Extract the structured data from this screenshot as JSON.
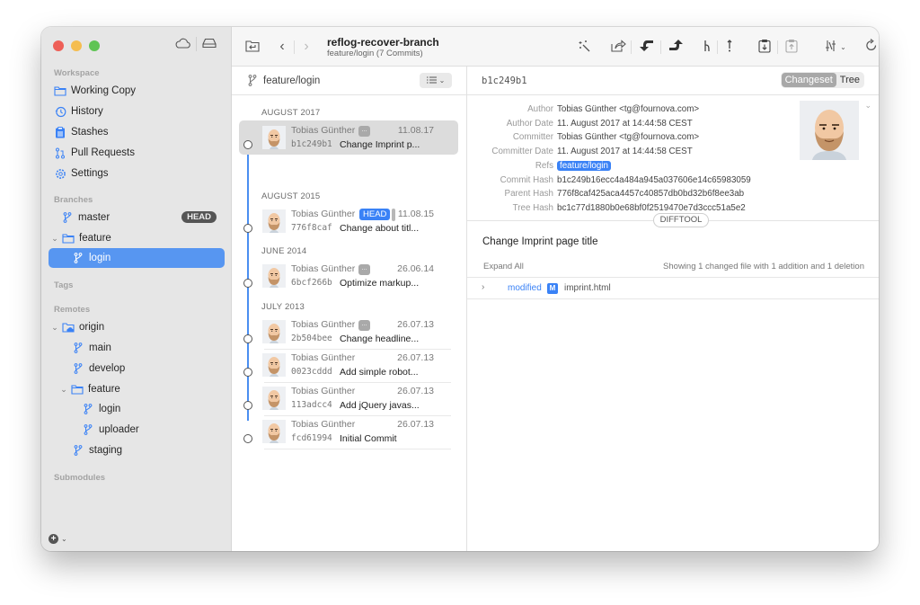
{
  "sidebar": {
    "workspace_label": "Workspace",
    "workspace_items": [
      {
        "label": "Working Copy",
        "icon": "folder-icon"
      },
      {
        "label": "History",
        "icon": "history-icon"
      },
      {
        "label": "Stashes",
        "icon": "clipboard-icon"
      },
      {
        "label": "Pull Requests",
        "icon": "pull-request-icon"
      },
      {
        "label": "Settings",
        "icon": "gear-icon"
      }
    ],
    "branches_label": "Branches",
    "branches": {
      "master": "master",
      "head_badge": "HEAD",
      "feature_folder": "feature",
      "login": "login"
    },
    "tags_label": "Tags",
    "remotes_label": "Remotes",
    "remotes": {
      "origin": "origin",
      "main": "main",
      "develop": "develop",
      "feature_folder": "feature",
      "login": "login",
      "uploader": "uploader",
      "staging": "staging"
    },
    "submodules_label": "Submodules"
  },
  "toolbar": {
    "title": "reflog-recover-branch",
    "subtitle": "feature/login (7 Commits)",
    "icons": [
      "magic-wand-icon",
      "share-icon",
      "pull-icon",
      "push-icon",
      "merge-icon",
      "stash-icon",
      "stash-apply-icon",
      "stash-pop-icon",
      "filter-icon",
      "refresh-icon",
      "search-icon"
    ]
  },
  "commit_list": {
    "branch": "feature/login",
    "groups": [
      {
        "month": "AUGUST 2017"
      },
      {
        "month": "AUGUST 2015"
      },
      {
        "month": "JUNE 2014"
      },
      {
        "month": "JULY 2013"
      }
    ],
    "commits": [
      {
        "author": "Tobias Günther",
        "date": "11.08.17",
        "hash": "b1c249b1",
        "message": "Change Imprint p...",
        "more": "...",
        "selected": true
      },
      {
        "author": "Tobias Günther",
        "date": "11.08.15",
        "hash": "776f8caf",
        "message": "Change about titl...",
        "tag": "HEAD"
      },
      {
        "author": "Tobias Günther",
        "date": "26.06.14",
        "hash": "6bcf266b",
        "message": "Optimize markup...",
        "more": "..."
      },
      {
        "author": "Tobias Günther",
        "date": "26.07.13",
        "hash": "2b504bee",
        "message": "Change headline...",
        "more": "..."
      },
      {
        "author": "Tobias Günther",
        "date": "26.07.13",
        "hash": "0023cddd",
        "message": "Add simple robot..."
      },
      {
        "author": "Tobias Günther",
        "date": "26.07.13",
        "hash": "113adcc4",
        "message": "Add jQuery javas..."
      },
      {
        "author": "Tobias Günther",
        "date": "26.07.13",
        "hash": "fcd61994",
        "message": "Initial Commit"
      }
    ]
  },
  "detail": {
    "short_hash": "b1c249b1",
    "view_toggle": {
      "changeset": "Changeset",
      "tree": "Tree",
      "active": "Changeset"
    },
    "meta": [
      {
        "key": "Author",
        "value": "Tobias Günther <tg@fournova.com>"
      },
      {
        "key": "Author Date",
        "value": "11. August 2017 at 14:44:58 CEST"
      },
      {
        "key": "Committer",
        "value": "Tobias Günther <tg@fournova.com>"
      },
      {
        "key": "Committer Date",
        "value": "11. August 2017 at 14:44:58 CEST"
      },
      {
        "key": "Refs",
        "value": "feature/login"
      },
      {
        "key": "Commit Hash",
        "value": "b1c249b16ecc4a484a945a037606e14c65983059"
      },
      {
        "key": "Parent Hash",
        "value": "776f8caf425aca4457c40857db0bd32b6f8ee3ab"
      },
      {
        "key": "Tree Hash",
        "value": "bc1c77d1880b0e68bf0f2519470e7d3ccc51a5e2"
      }
    ],
    "difftool_label": "DIFFTOOL",
    "commit_title": "Change Imprint page title",
    "expand_all": "Expand All",
    "summary": "Showing 1 changed file with 1 addition and 1 deletion",
    "files": [
      {
        "status": "modified",
        "badge": "M",
        "name": "imprint.html"
      }
    ]
  },
  "colors": {
    "accent": "#3a82f6",
    "sidebar_selected": "#5796f1",
    "graph_line": "#4a8ef0"
  }
}
